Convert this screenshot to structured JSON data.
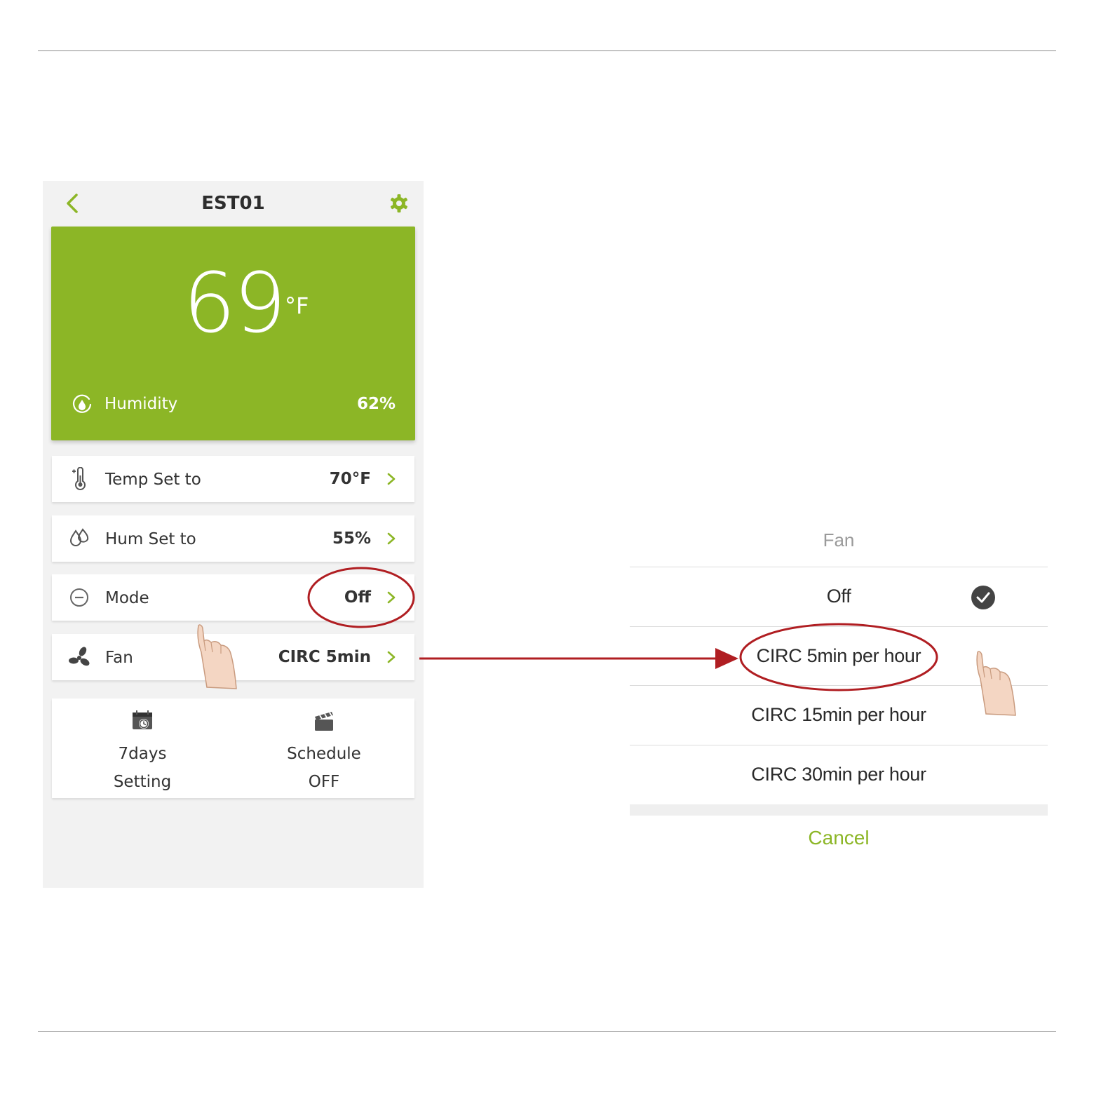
{
  "app": {
    "title": "EST01",
    "back_icon": "chevron-left-icon",
    "settings_icon": "gear-icon",
    "accent_color": "#8cb626"
  },
  "temperature": {
    "value": "69",
    "unit": "°F",
    "humidity_label": "Humidity",
    "humidity_value": "62%"
  },
  "settings": [
    {
      "icon": "thermometer-icon",
      "label": "Temp Set to",
      "value": "70°F"
    },
    {
      "icon": "water-drops-icon",
      "label": "Hum Set to",
      "value": "55%"
    },
    {
      "icon": "minus-circle-icon",
      "label": "Mode",
      "value": "Off"
    },
    {
      "icon": "fan-icon",
      "label": "Fan",
      "value": "CIRC 5min"
    }
  ],
  "tiles": [
    {
      "icon": "calendar-clock-icon",
      "line1": "7days",
      "line2": "Setting"
    },
    {
      "icon": "clapperboard-icon",
      "line1": "Schedule",
      "line2": "OFF"
    }
  ],
  "picker": {
    "title": "Fan",
    "options": [
      {
        "label": "Off",
        "selected": true
      },
      {
        "label": "CIRC 5min per hour",
        "selected": false
      },
      {
        "label": "CIRC 15min per hour",
        "selected": false
      },
      {
        "label": "CIRC 30min per hour",
        "selected": false
      }
    ],
    "cancel": "Cancel"
  },
  "annotations": {
    "highlight_color": "#b01e22",
    "pointer_icon": "hand-pointer-icon"
  }
}
